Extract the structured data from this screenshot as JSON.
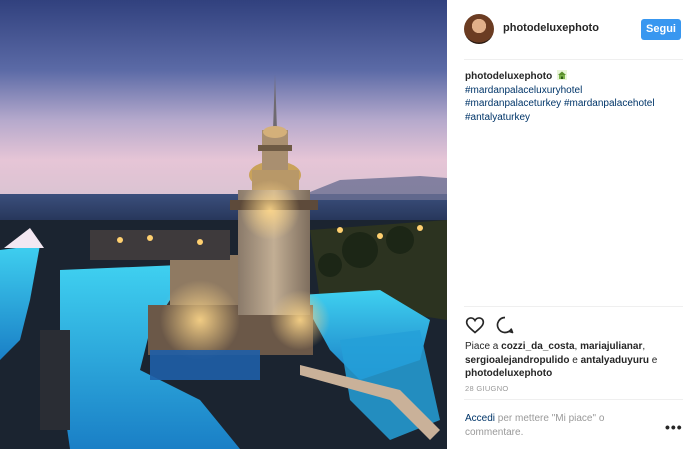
{
  "header": {
    "username": "photodeluxephoto",
    "follow_label": "Segui"
  },
  "caption": {
    "username": "photodeluxephoto",
    "hashtags": [
      "#mardanpalaceluxuryhotel",
      "#mardanpalaceturkey",
      "#mardanpalacehotel",
      "#antalyaturkey"
    ]
  },
  "likes": {
    "prefix": "Piace a",
    "users": [
      "cozzi_da_costa",
      "mariajulianar",
      "sergioalejandropulido",
      "antalyaduyuru",
      "photodeluxephoto"
    ],
    "sep": ", ",
    "and": "e"
  },
  "date": "28 GIUGNO",
  "login": {
    "link": "Accedi",
    "text": "per mettere \"Mi piace\" o commentare."
  },
  "more_label": "•••",
  "icons": {
    "like": "heart-icon",
    "comment": "comment-icon",
    "caption_emoji": "house-emoji-icon",
    "more": "more-options-icon"
  },
  "colors": {
    "accent": "#3897f0",
    "link": "#003569",
    "muted": "#999999",
    "text": "#262626"
  }
}
